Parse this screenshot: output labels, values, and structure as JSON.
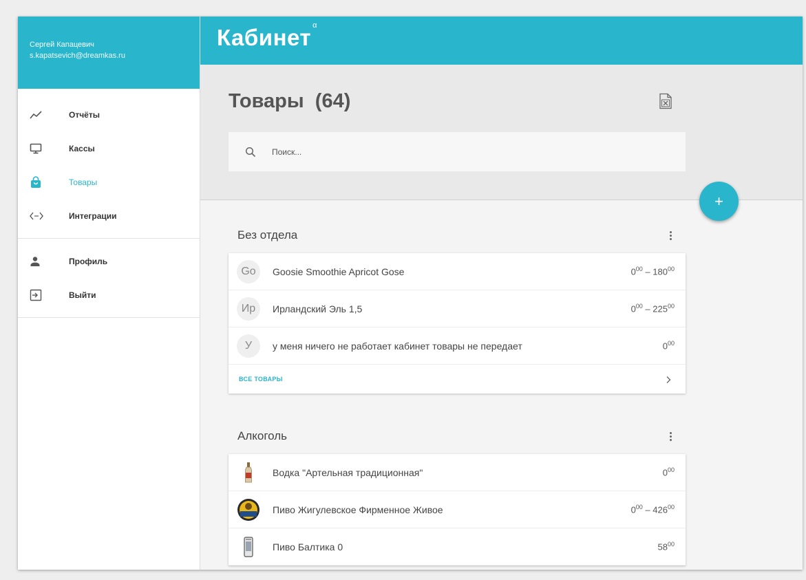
{
  "user": {
    "name": "Сергей Капацевич",
    "email": "s.kapatsevich@dreamkas.ru"
  },
  "nav": {
    "items": [
      {
        "label": "Отчёты",
        "icon": "chart-line-icon"
      },
      {
        "label": "Кассы",
        "icon": "monitor-icon"
      },
      {
        "label": "Товары",
        "icon": "shopping-bag-icon",
        "active": true
      },
      {
        "label": "Интеграции",
        "icon": "code-icon"
      }
    ],
    "bottom_items": [
      {
        "label": "Профиль",
        "icon": "person-icon"
      },
      {
        "label": "Выйти",
        "icon": "exit-icon"
      }
    ]
  },
  "header": {
    "brand": "Кабинет",
    "brand_sup": "α"
  },
  "page": {
    "title": "Товары",
    "count": "(64)"
  },
  "search": {
    "placeholder": "Поиск..."
  },
  "fab": {
    "label": "+"
  },
  "sections": [
    {
      "title": "Без отдела",
      "items": [
        {
          "avatar": "Go",
          "name": "Goosie Smoothie Apricot Gose",
          "price_from": "0",
          "price_from_kop": "00",
          "price_to": "180",
          "price_to_kop": "00"
        },
        {
          "avatar": "Ир",
          "name": "Ирландский Эль 1,5",
          "price_from": "0",
          "price_from_kop": "00",
          "price_to": "225",
          "price_to_kop": "00"
        },
        {
          "avatar": "У",
          "name": "у меня ничего не работает кабинет товары не передает",
          "price_from": "0",
          "price_from_kop": "00"
        }
      ],
      "all_label": "ВСЕ ТОВАРЫ"
    },
    {
      "title": "Алкоголь",
      "items": [
        {
          "thumb": "bottle-thumbnail",
          "name": "Водка \"Артельная традиционная\"",
          "price_from": "0",
          "price_from_kop": "00"
        },
        {
          "thumb": "beer-label-thumbnail",
          "name": "Пиво Жигулевское Фирменное Живое",
          "price_from": "0",
          "price_from_kop": "00",
          "price_to": "426",
          "price_to_kop": "00"
        },
        {
          "thumb": "can-thumbnail",
          "name": "Пиво Балтика 0",
          "price_from": "58",
          "price_from_kop": "00"
        }
      ]
    }
  ],
  "colors": {
    "accent": "#29b6cd",
    "background": "#f4f4f4"
  }
}
